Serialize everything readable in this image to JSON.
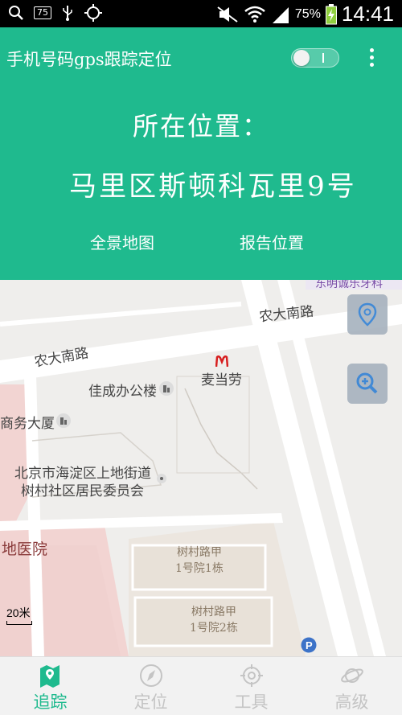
{
  "status_bar": {
    "notification_count": "75",
    "battery_percent": "75%",
    "time": "14:41"
  },
  "app_bar": {
    "title": "手机号码gps跟踪定位"
  },
  "location_panel": {
    "label": "所在位置：",
    "address": "马里区斯顿科瓦里9号",
    "panorama_button": "全景地图",
    "report_button": "报告位置"
  },
  "map": {
    "labels": {
      "road_top": "农大南路",
      "road_left": "农大南路",
      "mcdonalds": "麦当劳",
      "building_jiacheng": "佳成办公楼",
      "building_business": "商务大厦",
      "committee_line1": "北京市海淀区上地街道",
      "committee_line2": "树村社区居民委员会",
      "hospital": "地医院",
      "house1_line1": "树村路甲",
      "house1_line2": "1号院1栋",
      "house2_line1": "树村路甲",
      "house2_line2": "1号院2栋",
      "top_right_poi": "东明诚乐牙科"
    },
    "scale": "20米",
    "colors": {
      "hospital_area": "#f2d4d2",
      "residential_area": "#ece6df",
      "road": "#ffffff",
      "button": "#a6b2be",
      "button_icon": "#2f7fd3"
    }
  },
  "bottom_nav": {
    "items": [
      {
        "label": "追踪",
        "icon": "map-pin-icon",
        "active": true
      },
      {
        "label": "定位",
        "icon": "compass-icon",
        "active": false
      },
      {
        "label": "工具",
        "icon": "crosshair-icon",
        "active": false
      },
      {
        "label": "高级",
        "icon": "planet-icon",
        "active": false
      }
    ]
  },
  "theme": {
    "accent": "#1fba8e",
    "inactive": "#c4c4c4"
  }
}
